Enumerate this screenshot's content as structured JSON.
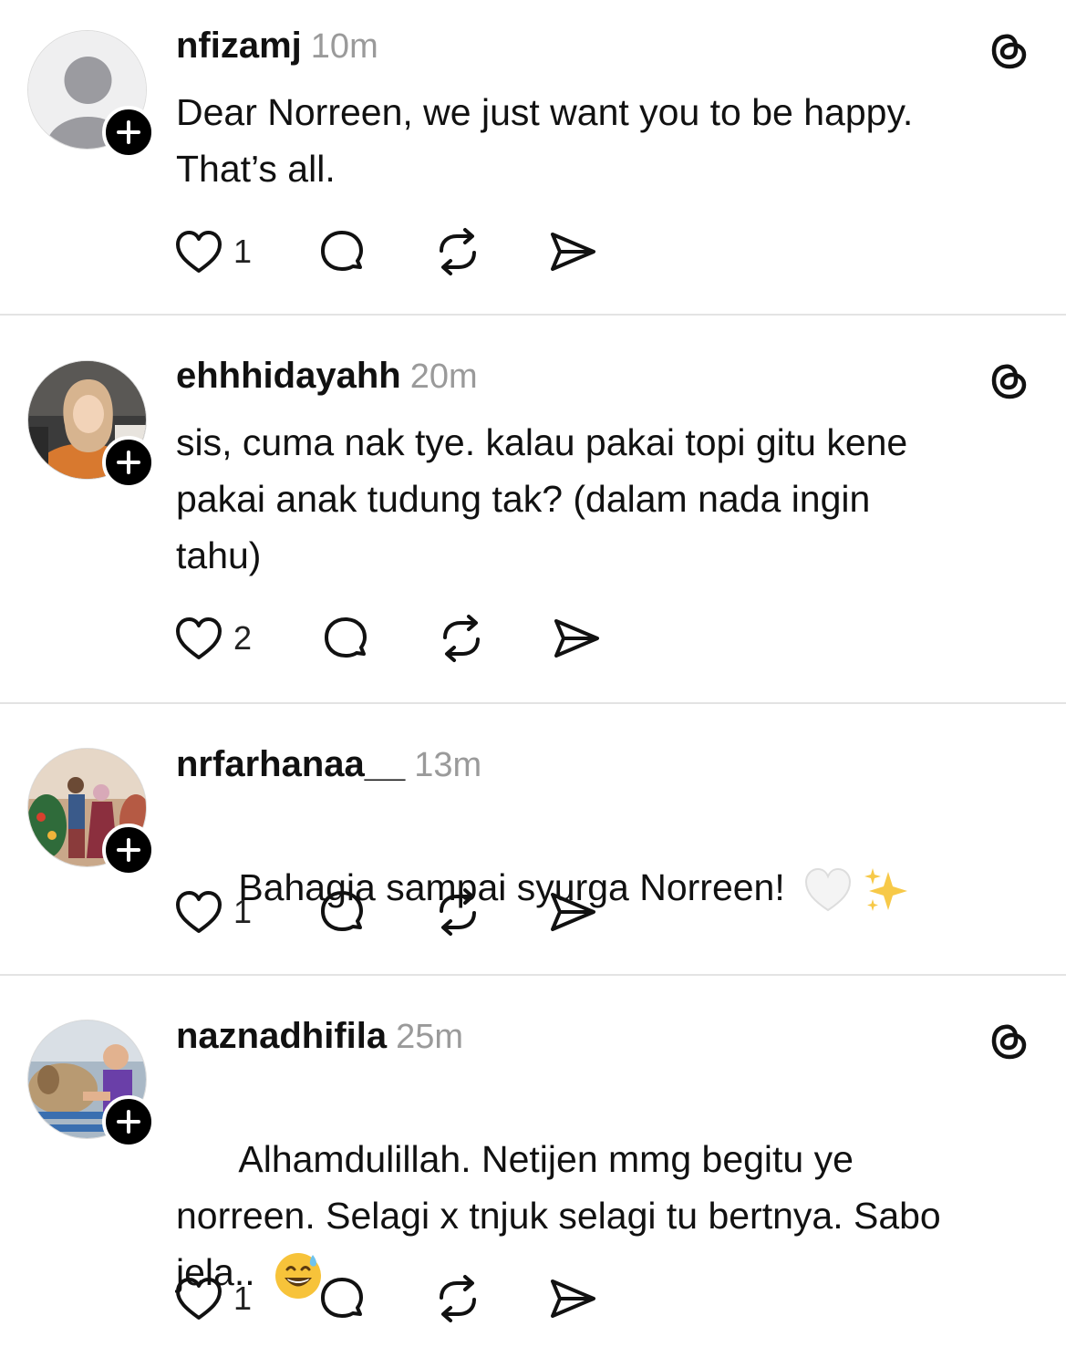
{
  "posts": [
    {
      "username": "nfizamj",
      "time": "10m",
      "text": "Dear Norreen, we just want you to be happy.\nThat’s all.",
      "likes": "1",
      "avatar": "default-profile",
      "show_threads_logo": true,
      "emoji": null
    },
    {
      "username": "ehhhidayahh",
      "time": "20m",
      "text": "sis, cuma nak tye. kalau pakai topi gitu kene\npakai anak tudung tak? (dalam nada ingin\ntahu)",
      "likes": "2",
      "avatar": "photo-woman-hijab",
      "show_threads_logo": true,
      "emoji": null
    },
    {
      "username": "nrfarhanaa__",
      "time": "13m",
      "text": "Bahagia sampai syurga Norreen! ",
      "likes": "1",
      "avatar": "photo-couple",
      "show_threads_logo": false,
      "emoji": "white-heart sparkles"
    },
    {
      "username": "naznadhifila",
      "time": "25m",
      "text": "Alhamdulillah. Netijen mmg begitu ye\nnorreen. Selagi x tnjuk selagi tu bertnya. Sabo\njela.. ",
      "likes": "1",
      "avatar": "photo-child-farm",
      "show_threads_logo": true,
      "emoji": "grinning-sweat"
    }
  ],
  "icons": {
    "like": "heart-icon",
    "reply": "comment-bubble-icon",
    "repost": "repost-icon",
    "share": "send-icon",
    "follow": "plus-icon",
    "brand": "threads-logo-icon"
  },
  "colors": {
    "text": "#111111",
    "muted": "#9a9a9a",
    "divider": "#e3e3e3"
  }
}
